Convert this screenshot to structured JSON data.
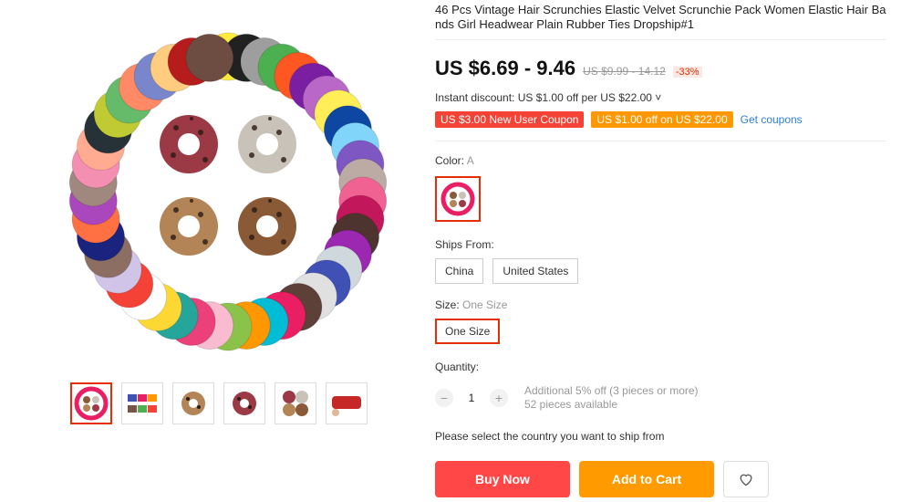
{
  "product": {
    "title": "46 Pcs Vintage Hair Scrunchies Elastic Velvet Scrunchie Pack Women Elastic Hair Bands Girl Headwear Plain Rubber Ties Dropship#1",
    "price": "US $6.69 - 9.46",
    "original_price": "US $9.99 - 14.12",
    "discount": "-33%"
  },
  "instant_discount": "Instant discount: US $1.00 off per US $22.00 ˅",
  "coupons": {
    "new_user": "US $3.00 New User Coupon",
    "store": "US $1.00 off on US $22.00",
    "get_link": "Get coupons"
  },
  "color": {
    "label": "Color:",
    "value": "A"
  },
  "ships_from": {
    "label": "Ships From:",
    "options": [
      "China",
      "United States"
    ]
  },
  "size": {
    "label": "Size:",
    "value": "One Size",
    "option": "One Size"
  },
  "quantity": {
    "label": "Quantity:",
    "value": "1",
    "minus": "−",
    "plus": "+",
    "note1": "Additional 5% off (3 pieces or more)",
    "note2": "52 pieces available"
  },
  "ship_note": "Please select the country you want to ship from",
  "buttons": {
    "buy_now": "Buy Now",
    "add_to_cart": "Add to Cart"
  },
  "icons": {
    "wishlist": "heart-icon"
  },
  "colors": {
    "accent": "#e62e04",
    "buy": "#ff4747",
    "cart": "#ff9a00",
    "coupon_red": "#f44336",
    "coupon_orange": "#ff9800",
    "link": "#2e7fd0"
  }
}
